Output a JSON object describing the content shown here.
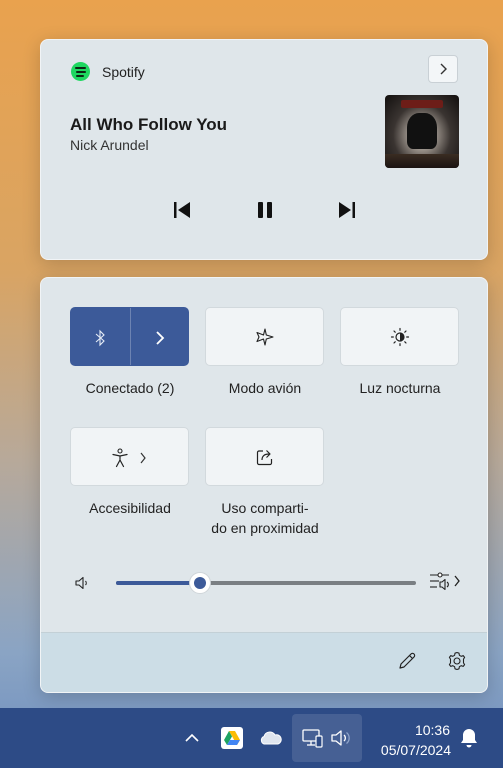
{
  "media": {
    "app_name": "Spotify",
    "song_title": "All Who Follow You",
    "artist": "Nick Arundel",
    "icons": {
      "app": "spotify-logo-icon",
      "open": "chevron-right-icon",
      "previous": "skip-previous-icon",
      "play_pause": "pause-icon",
      "next": "skip-next-icon"
    }
  },
  "quick_settings": {
    "tiles": [
      {
        "label": "Conectado (2)",
        "icon": "bluetooth-icon",
        "active": true,
        "has_chevron": true
      },
      {
        "label": "Modo avión",
        "icon": "airplane-icon",
        "active": false
      },
      {
        "label": "Luz nocturna",
        "icon": "night-light-icon",
        "active": false
      },
      {
        "label": "Accesibilidad",
        "icon": "accessibility-icon",
        "active": false,
        "has_chevron": true
      },
      {
        "label_line1": "Uso comparti-",
        "label_line2": "do en proximidad",
        "icon": "nearby-share-icon",
        "active": false
      }
    ],
    "volume": {
      "icon": "speaker-icon",
      "level_fraction": 0.28,
      "mixer_icon": "audio-mixer-icon"
    },
    "footer": {
      "edit_icon": "pencil-icon",
      "settings_icon": "gear-icon"
    }
  },
  "taskbar": {
    "icons": [
      "chevron-up-icon",
      "google-drive-icon",
      "onedrive-cloud-icon",
      "network-icon",
      "speaker-icon",
      "bell-icon"
    ],
    "time": "10:36",
    "date": "05/07/2024"
  },
  "colors": {
    "accent": "#3c5a99",
    "taskbar": "#2d4b86",
    "spotify": "#1ed760"
  }
}
